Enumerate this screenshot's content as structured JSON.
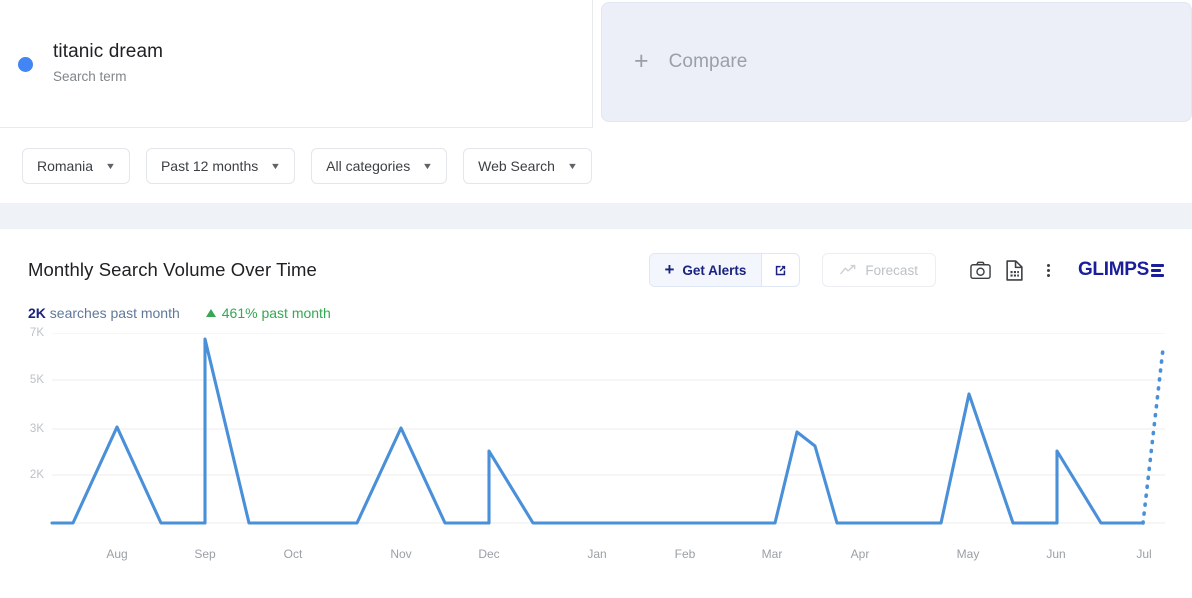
{
  "term": {
    "dot_color": "#4285f4",
    "name": "titanic dream",
    "subtitle": "Search term"
  },
  "compare": {
    "plus": "+",
    "label": "Compare"
  },
  "filters": [
    {
      "label": "Romania"
    },
    {
      "label": "Past 12 months"
    },
    {
      "label": "All categories"
    },
    {
      "label": "Web Search"
    }
  ],
  "chart_header": {
    "title": "Monthly Search Volume Over Time",
    "get_alerts_label": "Get Alerts",
    "get_alerts_plus": "+",
    "forecast_label": "Forecast",
    "logo_text": "GLIMPS"
  },
  "stats": {
    "value": "2K",
    "value_suffix": " searches past month",
    "delta": "461% past month"
  },
  "chart_data": {
    "type": "line",
    "title": "Monthly Search Volume Over Time",
    "xlabel": "",
    "ylabel": "",
    "categories": [
      "Aug",
      "Sep",
      "Oct",
      "Nov",
      "Dec",
      "Jan",
      "Feb",
      "Mar",
      "Apr",
      "May",
      "Jun",
      "Jul"
    ],
    "yticks": [
      "2K",
      "3K",
      "5K",
      "7K"
    ],
    "ytick_values": [
      2000,
      3000,
      5000,
      7000
    ],
    "ylim": [
      0,
      7600
    ],
    "grid": true,
    "legend": false,
    "line_color": "#4a90d9",
    "series": [
      {
        "name": "titanic dream",
        "points": [
          {
            "x": "Jul (prev)",
            "value": 0
          },
          {
            "x": "Aug",
            "value": 3100
          },
          {
            "x": "Aug-end",
            "value": 0
          },
          {
            "x": "Sep",
            "value": 7000
          },
          {
            "x": "Sep-end",
            "value": 0
          },
          {
            "x": "Oct",
            "value": 0
          },
          {
            "x": "Nov",
            "value": 3050
          },
          {
            "x": "Nov-end",
            "value": 0
          },
          {
            "x": "Dec",
            "value": 2400
          },
          {
            "x": "Dec-end",
            "value": 0
          },
          {
            "x": "Jan",
            "value": 0
          },
          {
            "x": "Feb",
            "value": 0
          },
          {
            "x": "Mar",
            "value": 2900
          },
          {
            "x": "Mar-tail",
            "value": 2550
          },
          {
            "x": "Apr",
            "value": 0
          },
          {
            "x": "May",
            "value": 4300
          },
          {
            "x": "May-end",
            "value": 0
          },
          {
            "x": "Jun",
            "value": 2400
          },
          {
            "x": "Jun-end",
            "value": 0
          }
        ]
      },
      {
        "name": "forecast",
        "style": "dotted",
        "points": [
          {
            "x": "Jul",
            "value": 0
          },
          {
            "x": "Jul-proj",
            "value": 6400
          }
        ]
      }
    ]
  }
}
